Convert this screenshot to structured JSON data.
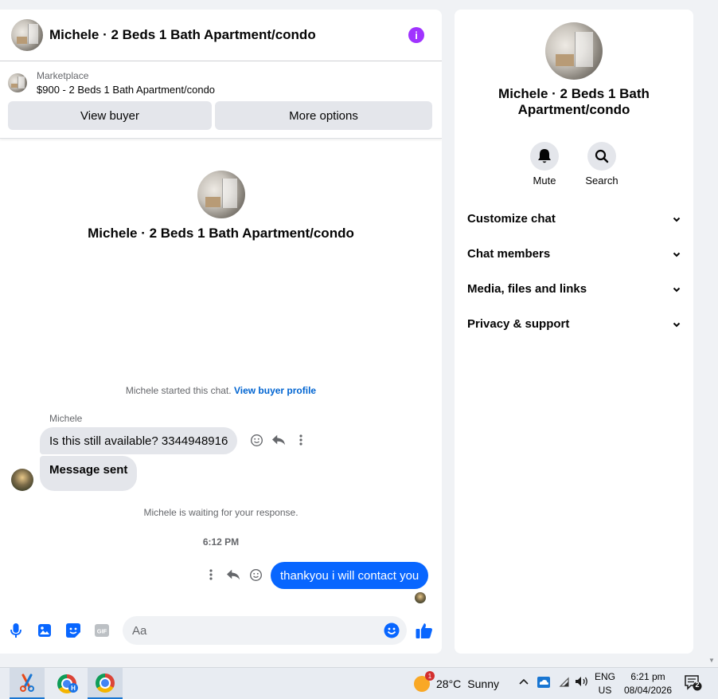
{
  "chat": {
    "title": "Michele · 2 Beds 1 Bath Apartment/condo",
    "marketplace_label": "Marketplace",
    "listing": "$900 - 2 Beds 1 Bath Apartment/condo",
    "view_buyer": "View buyer",
    "more_options": "More options",
    "intro_title": "Michele · 2 Beds 1 Bath Apartment/condo",
    "started_note": "Michele started this chat.",
    "buyer_profile_link": "View buyer profile",
    "sender_name": "Michele",
    "msg_1": "Is this still available? 3344948916",
    "msg_2": "Message sent",
    "waiting_note": "Michele is waiting for your response.",
    "timestamp": "6:12 PM",
    "reply": "thankyou i will contact you",
    "input_placeholder": "Aa"
  },
  "info_panel": {
    "title": "Michele · 2 Beds 1 Bath Apartment/condo",
    "mute": "Mute",
    "search": "Search",
    "sections": [
      "Customize chat",
      "Chat members",
      "Media, files and links",
      "Privacy & support"
    ]
  },
  "taskbar": {
    "temperature": "28°C",
    "weather": "Sunny",
    "weather_badge": "1",
    "lang_1": "ENG",
    "lang_2": "US",
    "time": "6:21 pm",
    "date": "08/04/2026",
    "notifications": "2",
    "chrome_badge": "H"
  },
  "icons": [
    "info-icon",
    "microphone-icon",
    "photo-icon",
    "sticker-icon",
    "gif-icon",
    "emoji-icon",
    "like-icon",
    "react-icon",
    "reply-icon",
    "more-icon",
    "bell-icon",
    "search-icon",
    "chevron-down-icon"
  ],
  "colors": {
    "accent": "#0866ff",
    "info": "#a033ff",
    "link": "#0064d1"
  }
}
